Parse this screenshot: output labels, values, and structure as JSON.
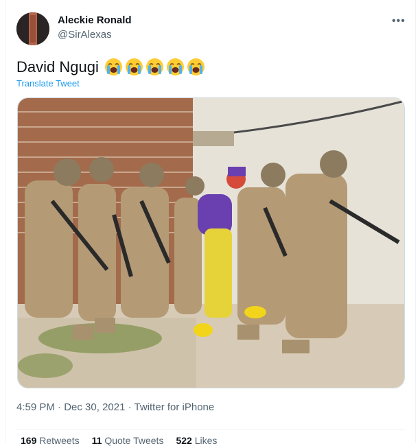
{
  "user": {
    "name": "Aleckie Ronald",
    "handle": "@SirAlexas"
  },
  "menu": {
    "more_label": "•••"
  },
  "tweet": {
    "text": "David Ngugi",
    "emoji_icons": [
      "loudly-crying-face-icon",
      "loudly-crying-face-icon",
      "loudly-crying-face-icon",
      "loudly-crying-face-icon",
      "loudly-crying-face-icon"
    ],
    "translate_label": "Translate Tweet"
  },
  "meta": {
    "time": "4:59 PM",
    "separator": " · ",
    "date": "Dec 30, 2021",
    "source": "Twitter for iPhone"
  },
  "stats": [
    {
      "count": "169",
      "label": "Retweets"
    },
    {
      "count": "11",
      "label": "Quote Tweets"
    },
    {
      "count": "522",
      "label": "Likes"
    }
  ],
  "colors": {
    "link": "#1d9bf0",
    "secondary_text": "#536471",
    "primary_text": "#0f1419",
    "border": "#cfd9de"
  }
}
